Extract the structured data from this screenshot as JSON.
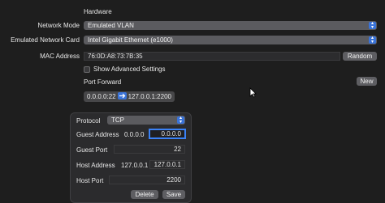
{
  "section_title": "Hardware",
  "network_mode": {
    "label": "Network Mode",
    "value": "Emulated VLAN"
  },
  "network_card": {
    "label": "Emulated Network Card",
    "value": "Intel Gigabit Ethernet (e1000)"
  },
  "mac": {
    "label": "MAC Address",
    "value": "76:0D:A8:73:7B:35",
    "random_label": "Random"
  },
  "advanced": {
    "label": "Show Advanced Settings"
  },
  "port_forward": {
    "label": "Port Forward",
    "new_label": "New",
    "rule": {
      "guest": "0.0.0.0:22",
      "host": "127.0.0.1:2200"
    }
  },
  "popover": {
    "protocol": {
      "label": "Protocol",
      "value": "TCP"
    },
    "guest_address": {
      "label": "Guest Address",
      "value": "0.0.0.0",
      "edit_value": "0.0.0.0"
    },
    "guest_port": {
      "label": "Guest Port",
      "value": "22"
    },
    "host_address": {
      "label": "Host Address",
      "value": "127.0.0.1",
      "edit_value": "127.0.0.1"
    },
    "host_port": {
      "label": "Host Port",
      "value": "2200"
    },
    "delete_label": "Delete",
    "save_label": "Save"
  },
  "colors": {
    "accent": "#3a73d8",
    "focus_ring": "#3b82f6",
    "background": "#1e1e1e"
  }
}
